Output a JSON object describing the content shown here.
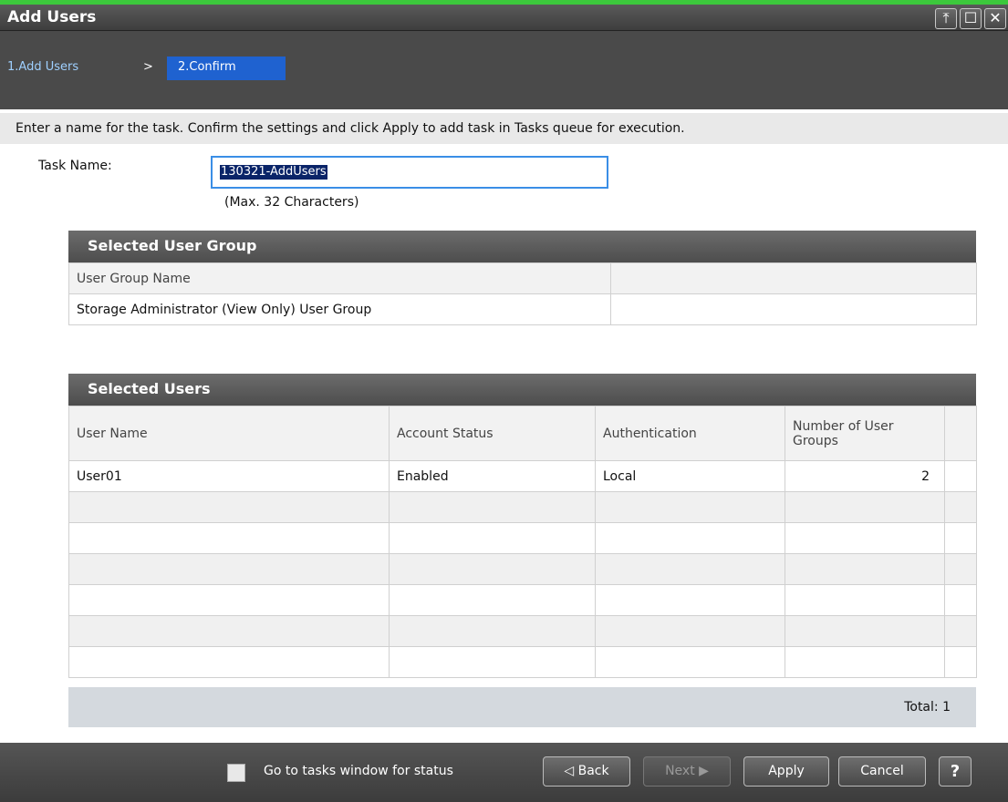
{
  "window": {
    "title": "Add Users",
    "buttons": {
      "pin": "⤒",
      "maximize": "☐",
      "close": "✕"
    }
  },
  "steps": {
    "step1": "1.Add Users",
    "separator": ">",
    "step2": "2.Confirm"
  },
  "instruction": "Enter a name for the task. Confirm the settings and click Apply to add task in Tasks queue for execution.",
  "task": {
    "label": "Task Name:",
    "value": "130321-AddUsers",
    "hint": "(Max. 32 Characters)"
  },
  "user_group_panel": {
    "title": "Selected User Group",
    "header": "User Group Name",
    "rows": [
      "Storage Administrator (View Only) User Group"
    ]
  },
  "users_panel": {
    "title": "Selected Users",
    "columns": [
      "User Name",
      "Account Status",
      "Authentication",
      "Number of User Groups"
    ],
    "rows": [
      {
        "user_name": "User01",
        "account_status": "Enabled",
        "authentication": "Local",
        "groups": "2"
      }
    ],
    "total_label": "Total:",
    "total_value": "1"
  },
  "footer": {
    "checkbox_label": "Go to tasks window for status",
    "back": "◁ Back",
    "next": "Next ▶",
    "apply": "Apply",
    "cancel": "Cancel",
    "help": "?"
  },
  "colors": {
    "accent": "#1f62d0",
    "titlebar_top": "#3cc83c",
    "focus": "#3a8ee6"
  }
}
